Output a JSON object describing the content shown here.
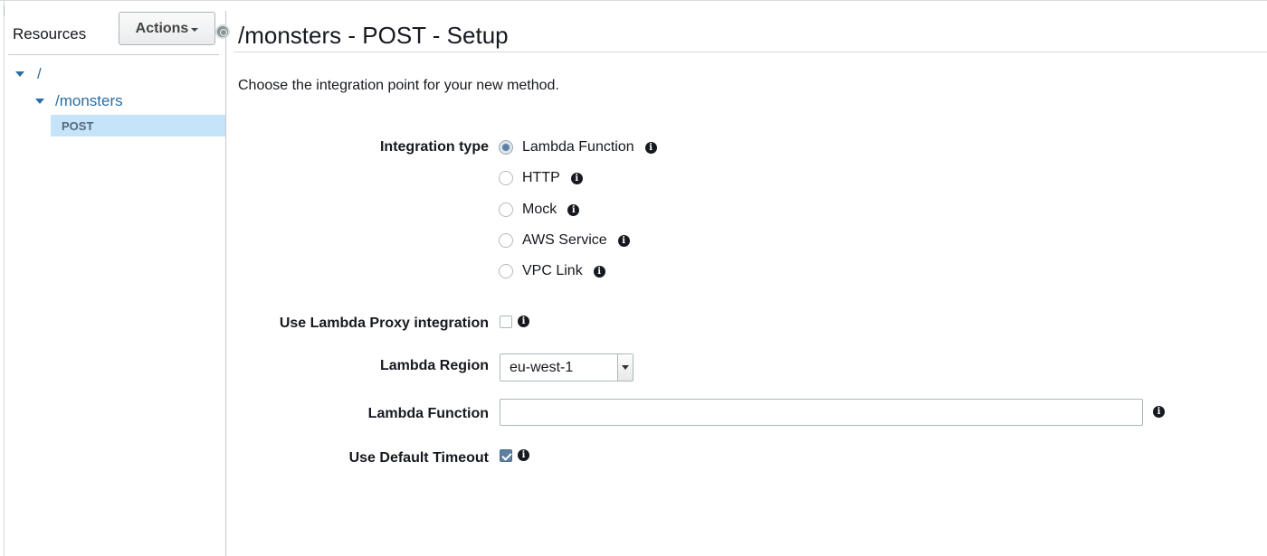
{
  "sidebar": {
    "header": "Resources",
    "actions_label": "Actions",
    "tree": {
      "root": "/",
      "child": "/monsters",
      "method": "POST"
    }
  },
  "main": {
    "title": "/monsters - POST - Setup",
    "intro": "Choose the integration point for your new method.",
    "integration_type": {
      "label": "Integration type",
      "selected": "Lambda Function",
      "options": [
        "Lambda Function",
        "HTTP",
        "Mock",
        "AWS Service",
        "VPC Link"
      ]
    },
    "proxy": {
      "label": "Use Lambda Proxy integration",
      "checked": false
    },
    "region": {
      "label": "Lambda Region",
      "value": "eu-west-1"
    },
    "function": {
      "label": "Lambda Function",
      "value": ""
    },
    "timeout": {
      "label": "Use Default Timeout",
      "checked": true
    }
  },
  "icons": {
    "info": "information-icon",
    "tree_expanded": "caret-down-icon"
  },
  "colors": {
    "link_blue": "#2a6ea3",
    "selected_row": "#c6e4f9",
    "checked_control": "#5e7fa0"
  }
}
